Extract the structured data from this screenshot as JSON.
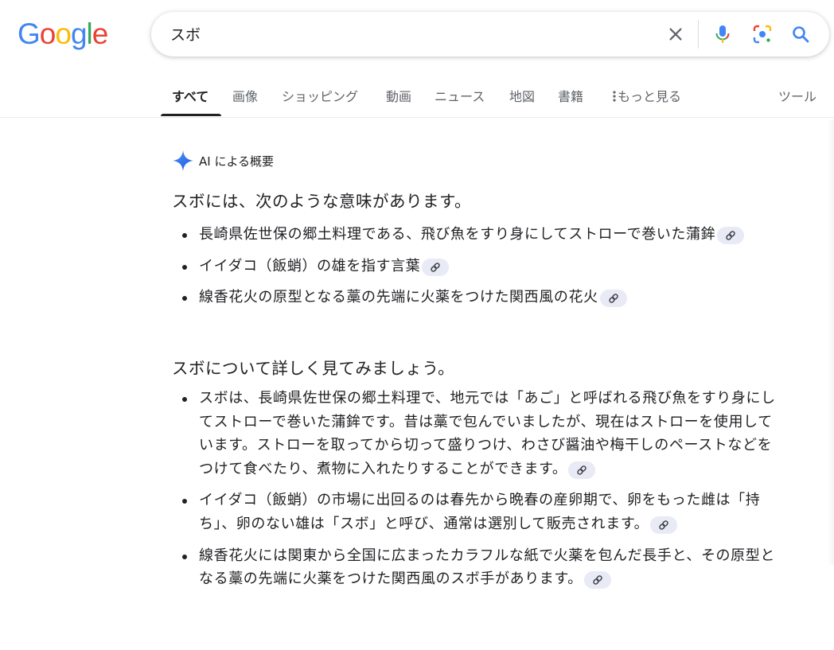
{
  "logo": {
    "letters": [
      "G",
      "o",
      "o",
      "g",
      "l",
      "e"
    ],
    "colors": [
      "#4285F4",
      "#EA4335",
      "#FBBC05",
      "#4285F4",
      "#34A853",
      "#EA4335"
    ]
  },
  "search": {
    "query": "スボ"
  },
  "icons": {
    "clear": "close-icon",
    "voice": "microphone-icon",
    "lens": "camera-lens-icon",
    "search": "search-icon",
    "link": "link-icon",
    "ai": "sparkle-icon",
    "more": "more-vert-icon"
  },
  "tabs": {
    "all": "すべて",
    "images": "画像",
    "shopping": "ショッピング",
    "videos": "動画",
    "news": "ニュース",
    "maps": "地図",
    "books": "書籍",
    "more": "もっと見る",
    "tools": "ツール"
  },
  "overview": {
    "label": "AI による概要",
    "intro": "スボには、次のような意味があります。",
    "meanings": [
      "長崎県佐世保の郷土料理である、飛び魚をすり身にしてストローで巻いた蒲鉾",
      "イイダコ（飯蛸）の雄を指す言葉",
      "線香花火の原型となる藁の先端に火薬をつけた関西風の花火"
    ],
    "details_title": "スボについて詳しく見てみましょう。",
    "details": [
      "スボは、長崎県佐世保の郷土料理で、地元では「あご」と呼ばれる飛び魚をすり身にしてストローで巻いた蒲鉾です。昔は藁で包んでいましたが、現在はストローを使用しています。ストローを取ってから切って盛りつけ、わさび醤油や梅干しのペーストなどをつけて食べたり、煮物に入れたりすることができます。",
      "イイダコ（飯蛸）の市場に出回るのは春先から晩春の産卵期で、卵をもった雌は「持ち」、卵のない雄は「スボ」と呼び、通常は選別して販売されます。",
      "線香花火には関東から全国に広まったカラフルな紙で火薬を包んだ長手と、その原型となる藁の先端に火薬をつけた関西風のスボ手があります。"
    ]
  },
  "colors": {
    "accent": "#1a73e8",
    "chip": "#e8eaf6",
    "text": "#202124",
    "muted": "#5f6368"
  }
}
